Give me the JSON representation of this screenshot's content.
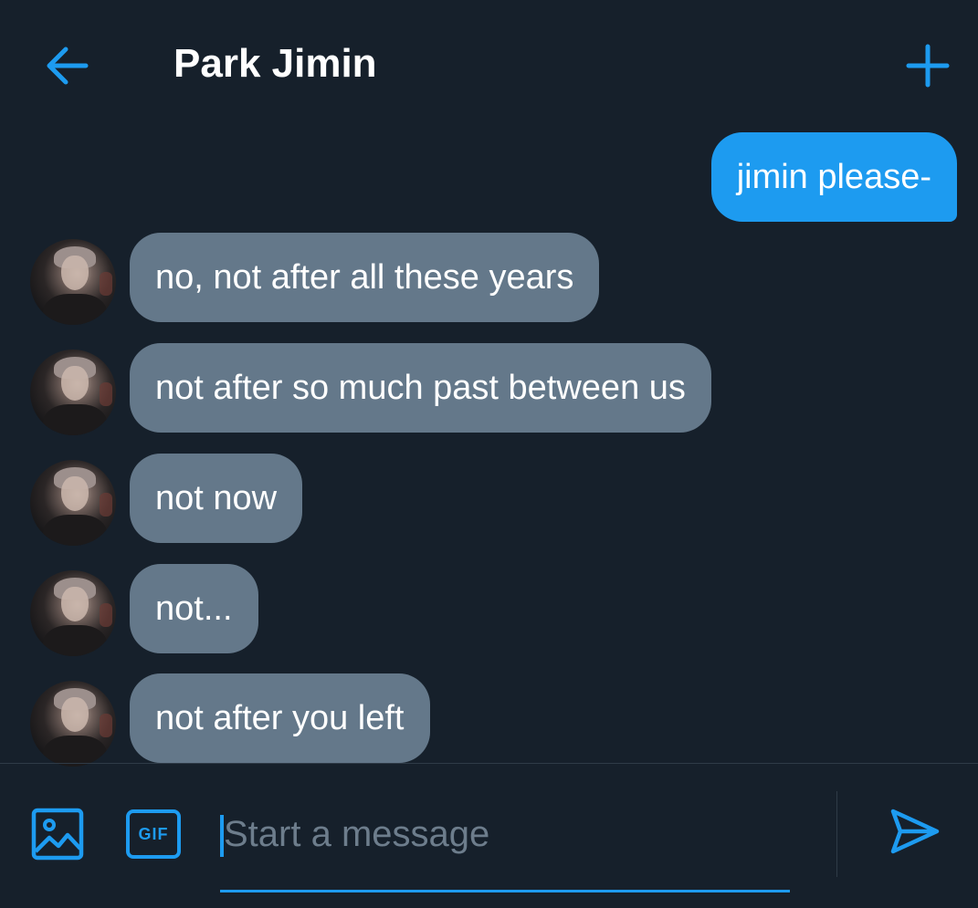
{
  "header": {
    "title": "Park Jimin",
    "back_icon": "arrow-left-icon",
    "add_icon": "plus-icon"
  },
  "messages": [
    {
      "from": "me",
      "text": "jimin please-"
    },
    {
      "from": "them",
      "text": "no, not after all these years"
    },
    {
      "from": "them",
      "text": "not after so much past between us"
    },
    {
      "from": "them",
      "text": "not now"
    },
    {
      "from": "them",
      "text": "not..."
    },
    {
      "from": "them",
      "text": "not after you left"
    }
  ],
  "composer": {
    "placeholder": "Start a message",
    "value": "",
    "media_icon": "image-icon",
    "gif_label": "GIF",
    "send_icon": "send-icon"
  },
  "colors": {
    "background": "#16202b",
    "accent": "#1d9bf0",
    "received_bubble": "#64788a",
    "placeholder": "#6d7d8c"
  }
}
